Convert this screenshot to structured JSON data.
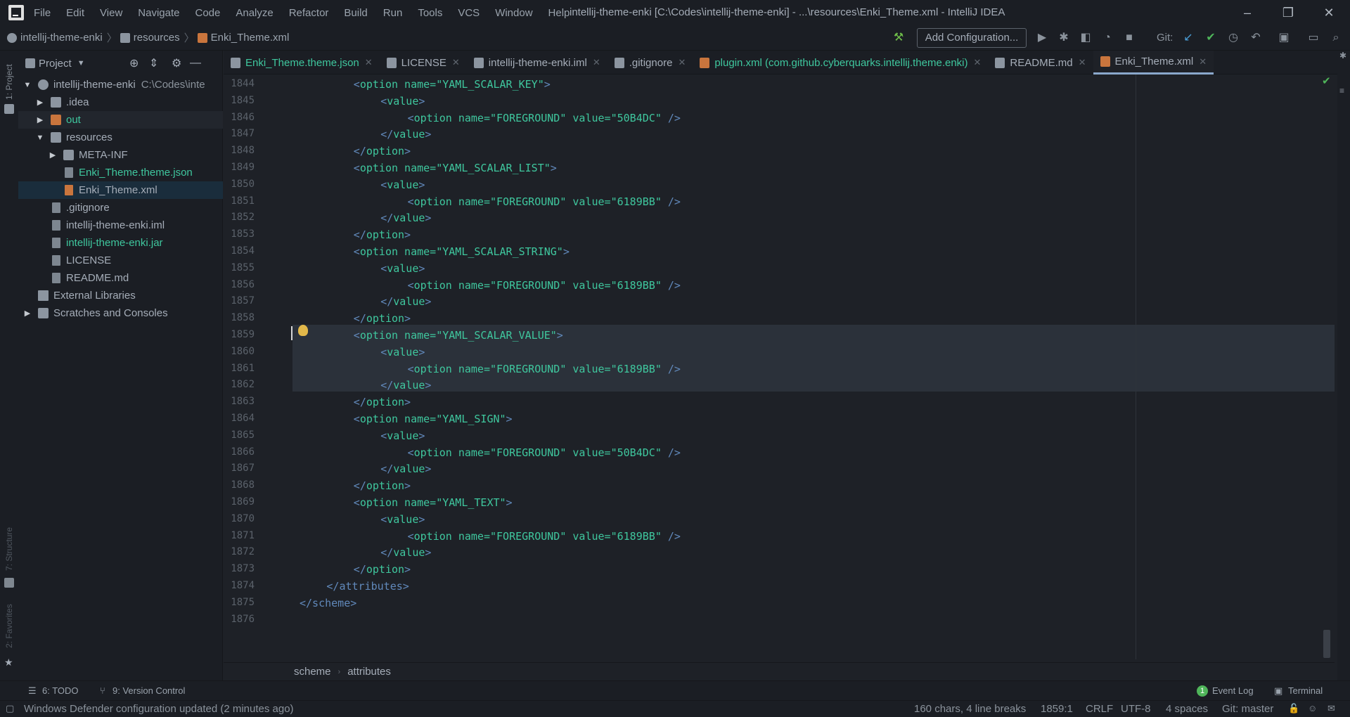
{
  "menubar": {
    "items": [
      "File",
      "Edit",
      "View",
      "Navigate",
      "Code",
      "Analyze",
      "Refactor",
      "Build",
      "Run",
      "Tools",
      "VCS",
      "Window",
      "Help"
    ],
    "window_title": "intellij-theme-enki [C:\\Codes\\intellij-theme-enki] - ...\\resources\\Enki_Theme.xml - IntelliJ IDEA"
  },
  "navbar": {
    "breadcrumbs": [
      "intellij-theme-enki",
      "resources",
      "Enki_Theme.xml"
    ],
    "add_configuration": "Add Configuration...",
    "git_label": "Git:"
  },
  "left_stripe": {
    "project": "1: Project",
    "structure": "7: Structure",
    "favorites": "2: Favorites"
  },
  "project_panel": {
    "title": "Project",
    "tree": [
      {
        "label": "intellij-theme-enki",
        "suffix": "C:\\Codes\\inte",
        "level": 0,
        "arrow": "▼"
      },
      {
        "label": ".idea",
        "level": 1,
        "arrow": "▶"
      },
      {
        "label": "out",
        "level": 1,
        "arrow": "▶",
        "color": "#3fc79e"
      },
      {
        "label": "resources",
        "level": 1,
        "arrow": "▼"
      },
      {
        "label": "META-INF",
        "level": 2,
        "arrow": "▶"
      },
      {
        "label": "Enki_Theme.theme.json",
        "level": 2,
        "arrow": "",
        "color": "#3fc79e"
      },
      {
        "label": "Enki_Theme.xml",
        "level": 2,
        "arrow": ""
      },
      {
        "label": ".gitignore",
        "level": 1,
        "arrow": ""
      },
      {
        "label": "intellij-theme-enki.iml",
        "level": 1,
        "arrow": ""
      },
      {
        "label": "intellij-theme-enki.jar",
        "level": 1,
        "arrow": "",
        "color": "#3fc79e"
      },
      {
        "label": "LICENSE",
        "level": 1,
        "arrow": ""
      },
      {
        "label": "README.md",
        "level": 1,
        "arrow": ""
      },
      {
        "label": "External Libraries",
        "level": 0,
        "arrow": ""
      },
      {
        "label": "Scratches and Consoles",
        "level": 0,
        "arrow": "▶"
      }
    ]
  },
  "tabs": [
    {
      "label": "Enki_Theme.theme.json",
      "color": "#3fc79e"
    },
    {
      "label": "LICENSE"
    },
    {
      "label": "intellij-theme-enki.iml"
    },
    {
      "label": ".gitignore"
    },
    {
      "label": "plugin.xml (com.github.cyberquarks.intellij.theme.enki)",
      "color": "#3fc79e"
    },
    {
      "label": "README.md"
    },
    {
      "label": "Enki_Theme.xml",
      "active": true
    }
  ],
  "editor": {
    "lines": [
      {
        "n": "1844",
        "indent": 8,
        "kind": "open",
        "name": "YAML_SCALAR_KEY"
      },
      {
        "n": "1845",
        "indent": 12,
        "kind": "value_open"
      },
      {
        "n": "1846",
        "indent": 16,
        "kind": "fg",
        "value": "50B4DC"
      },
      {
        "n": "1847",
        "indent": 12,
        "kind": "value_close"
      },
      {
        "n": "1848",
        "indent": 8,
        "kind": "close"
      },
      {
        "n": "1849",
        "indent": 8,
        "kind": "open",
        "name": "YAML_SCALAR_LIST"
      },
      {
        "n": "1850",
        "indent": 12,
        "kind": "value_open"
      },
      {
        "n": "1851",
        "indent": 16,
        "kind": "fg",
        "value": "6189BB"
      },
      {
        "n": "1852",
        "indent": 12,
        "kind": "value_close"
      },
      {
        "n": "1853",
        "indent": 8,
        "kind": "close"
      },
      {
        "n": "1854",
        "indent": 8,
        "kind": "open",
        "name": "YAML_SCALAR_STRING"
      },
      {
        "n": "1855",
        "indent": 12,
        "kind": "value_open"
      },
      {
        "n": "1856",
        "indent": 16,
        "kind": "fg",
        "value": "6189BB"
      },
      {
        "n": "1857",
        "indent": 12,
        "kind": "value_close"
      },
      {
        "n": "1858",
        "indent": 8,
        "kind": "close"
      },
      {
        "n": "1859",
        "indent": 8,
        "kind": "open",
        "name": "YAML_SCALAR_VALUE"
      },
      {
        "n": "1860",
        "indent": 12,
        "kind": "value_open"
      },
      {
        "n": "1861",
        "indent": 16,
        "kind": "fg",
        "value": "6189BB"
      },
      {
        "n": "1862",
        "indent": 12,
        "kind": "value_close"
      },
      {
        "n": "1863",
        "indent": 8,
        "kind": "close"
      },
      {
        "n": "1864",
        "indent": 8,
        "kind": "open",
        "name": "YAML_SIGN"
      },
      {
        "n": "1865",
        "indent": 12,
        "kind": "value_open"
      },
      {
        "n": "1866",
        "indent": 16,
        "kind": "fg",
        "value": "50B4DC"
      },
      {
        "n": "1867",
        "indent": 12,
        "kind": "value_close"
      },
      {
        "n": "1868",
        "indent": 8,
        "kind": "close"
      },
      {
        "n": "1869",
        "indent": 8,
        "kind": "open",
        "name": "YAML_TEXT"
      },
      {
        "n": "1870",
        "indent": 12,
        "kind": "value_open"
      },
      {
        "n": "1871",
        "indent": 16,
        "kind": "fg",
        "value": "6189BB"
      },
      {
        "n": "1872",
        "indent": 12,
        "kind": "value_close"
      },
      {
        "n": "1873",
        "indent": 8,
        "kind": "close"
      },
      {
        "n": "1874",
        "indent": 4,
        "kind": "raw",
        "text": "</attributes>"
      },
      {
        "n": "1875",
        "indent": 0,
        "kind": "raw",
        "text": "</scheme>"
      },
      {
        "n": "1876",
        "indent": 0,
        "kind": "empty"
      }
    ]
  },
  "editor_breadcrumbs": [
    "scheme",
    "attributes"
  ],
  "toolwindows": {
    "todo": "6: TODO",
    "vcs": "9: Version Control",
    "event_log": "Event Log",
    "event_count": "1",
    "terminal": "Terminal"
  },
  "statusbar": {
    "message": "Windows Defender configuration updated (2 minutes ago)",
    "selection": "160 chars, 4 line breaks",
    "position": "1859:1",
    "line_sep": "CRLF",
    "encoding": "UTF-8",
    "indent": "4 spaces",
    "git": "Git: master"
  }
}
